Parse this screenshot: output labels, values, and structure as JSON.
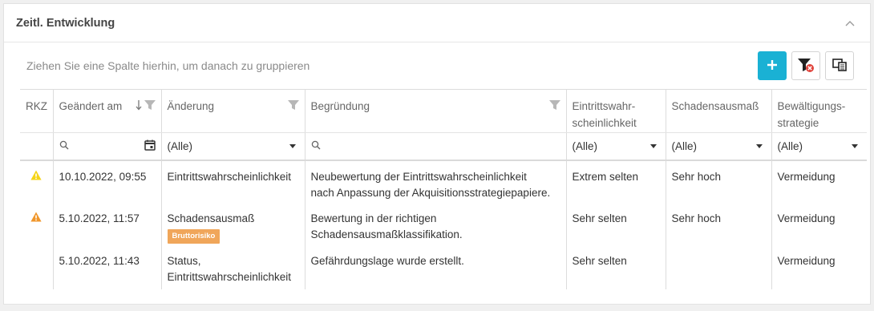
{
  "panel": {
    "title": "Zeitl. Entwicklung"
  },
  "group_hint": "Ziehen Sie eine Spalte hierhin, um danach zu gruppieren",
  "colors": {
    "accent": "#1ab1d4",
    "warning_yellow": "#f5d415",
    "warning_orange": "#f0962a",
    "badge": "#f0a65a"
  },
  "columns": {
    "rkz": "RKZ",
    "changed_at": "Geändert am",
    "change": "Änderung",
    "reason": "Begründung",
    "probability_1": "Eintrittswahr-",
    "probability_2": "scheinlichkeit",
    "damage": "Schadensausmaß",
    "strategy_1": "Bewältigungs-",
    "strategy_2": "strategie"
  },
  "filters": {
    "change": "(Alle)",
    "probability": "(Alle)",
    "damage": "(Alle)",
    "strategy": "(Alle)"
  },
  "rows": [
    {
      "rkz_icon": "warning-yellow-icon",
      "changed_at": "10.10.2022, 09:55",
      "change_1": "Eintrittswahrscheinlichkeit",
      "change_2": "",
      "badge": "",
      "reason_1": "Neubewertung der Eintrittswahrscheinlichkeit",
      "reason_2": "nach Anpassung der Akquisitionsstrategiepapiere.",
      "probability": "Extrem selten",
      "damage": "Sehr hoch",
      "strategy": "Vermeidung"
    },
    {
      "rkz_icon": "warning-orange-icon",
      "changed_at": "5.10.2022, 11:57",
      "change_1": "Schadensausmaß",
      "change_2": "",
      "badge": "Bruttorisiko",
      "reason_1": "Bewertung in der richtigen",
      "reason_2": "Schadensausmaßklassifikation.",
      "probability": "Sehr selten",
      "damage": "Sehr hoch",
      "strategy": "Vermeidung"
    },
    {
      "rkz_icon": "",
      "changed_at": "5.10.2022, 11:43",
      "change_1": "Status,",
      "change_2": "Eintrittswahrscheinlichkeit",
      "badge": "",
      "reason_1": "Gefährdungslage wurde erstellt.",
      "reason_2": "",
      "probability": "Sehr selten",
      "damage": "",
      "strategy": "Vermeidung"
    }
  ]
}
